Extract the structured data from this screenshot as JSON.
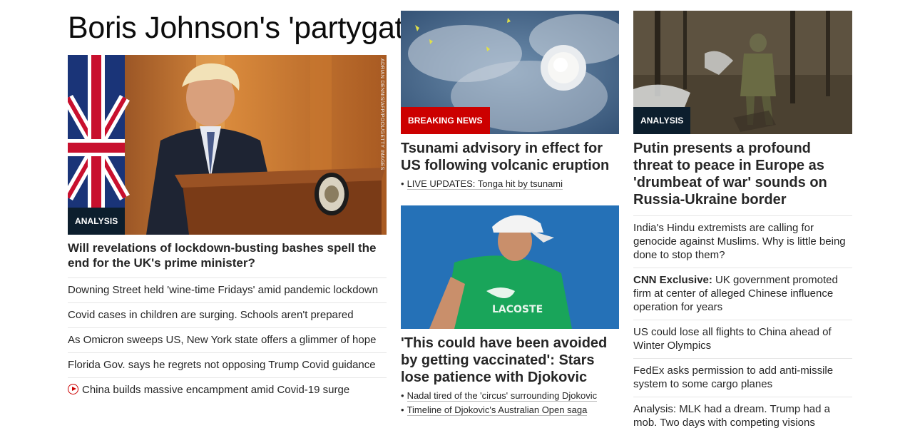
{
  "column1": {
    "headline": "Boris Johnson's 'partygate' hangover",
    "image_label": "ANALYSIS",
    "image_credit": "ADRIAN DENNIS/AFP/POOL/GETTY IMAGES",
    "lead_title": "Will revelations of lockdown-busting bashes spell the end for the UK's prime minister?",
    "links": [
      "Downing Street held 'wine-time Fridays' amid pandemic lockdown",
      "Covid cases in children are surging. Schools aren't prepared",
      "As Omicron sweeps US, New York state offers a glimmer of hope",
      "Florida Gov. says he regrets not opposing Trump Covid guidance",
      "China builds massive encampment amid Covid-19 surge"
    ],
    "video_icon": "play-icon"
  },
  "column2": {
    "story1": {
      "image_label": "BREAKING NEWS",
      "title": "Tsunami advisory in effect for US following volcanic eruption",
      "sublinks": [
        "LIVE UPDATES: Tonga hit by tsunami"
      ]
    },
    "story2": {
      "title": "'This could have been avoided by getting vaccinated': Stars lose patience with Djokovic",
      "sublinks": [
        "Nadal tired of the 'circus' surrounding Djokovic",
        "Timeline of Djokovic's Australian Open saga"
      ]
    }
  },
  "column3": {
    "image_label": "ANALYSIS",
    "title": "Putin presents a profound threat to peace in Europe as 'drumbeat of war' sounds on Russia-Ukraine border",
    "links": [
      {
        "prefix": "",
        "text": "India's Hindu extremists are calling for genocide against Muslims. Why is little being done to stop them?"
      },
      {
        "prefix": "CNN Exclusive:",
        "text": " UK government promoted firm at center of alleged Chinese influence operation for years"
      },
      {
        "prefix": "",
        "text": "US could lose all flights to China ahead of Winter Olympics"
      },
      {
        "prefix": "",
        "text": "FedEx asks permission to add anti-missile system to some cargo planes"
      },
      {
        "prefix": "",
        "text": "Analysis: MLK had a dream. Trump had a mob. Two days with competing visions"
      }
    ]
  },
  "colors": {
    "analysis_label_bg": "#0c1e2d",
    "breaking_label_bg": "#cc0000",
    "divider": "#e6e6e6"
  }
}
